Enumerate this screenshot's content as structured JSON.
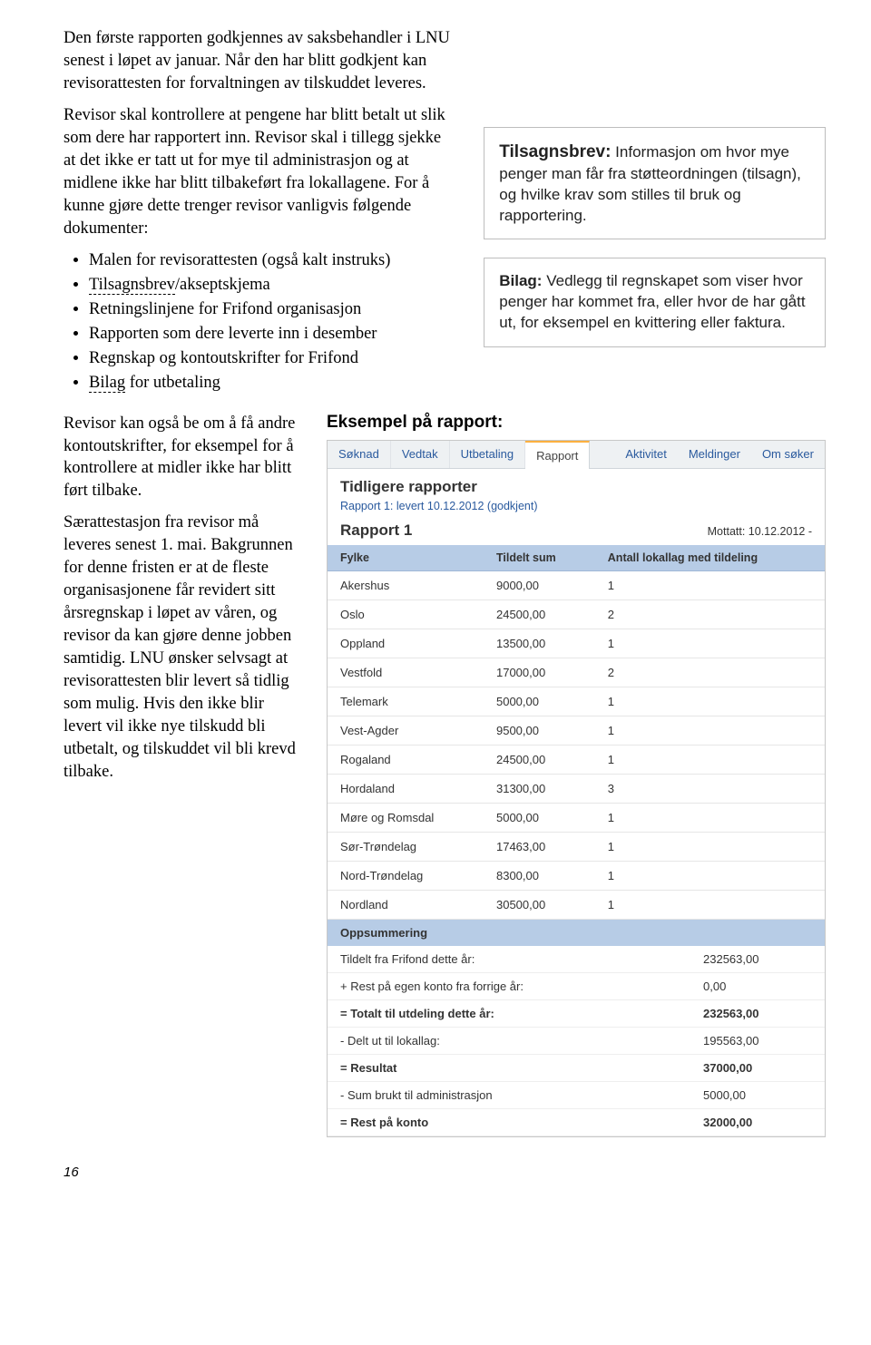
{
  "text": {
    "p1": "Den første rapporten godkjennes av saksbehandler i LNU senest i løpet av januar. Når den har blitt godkjent kan revisorattesten for forvaltningen av tilskuddet leveres.",
    "p2a": "Revisor skal kontrollere at pengene har blitt betalt ut slik som dere har rapportert inn. Revisor skal i tillegg sjekke at det ikke er tatt ut for mye til administrasjon og at midlene ikke har blitt tilbakeført fra lokallagene. For å kunne gjøre dette trenger revisor vanligvis følgende dokumenter:",
    "bullets": {
      "b1": "Malen for revisorattesten (også kalt instruks)",
      "b2a": "",
      "b2_dotted": "Tilsagnsbrev",
      "b2b": "/akseptskjema",
      "b3": "Retningslinjene for Frifond organisasjon",
      "b4": "Rapporten som dere leverte inn i desember",
      "b5": "Regnskap og kontoutskrifter for Frifond",
      "b6_dotted": "Bilag",
      "b6b": " for utbetaling"
    },
    "p3": "Revisor kan også be om å få andre kontoutskrifter, for eksempel for å kontrollere at midler ikke har blitt ført tilbake.",
    "p4": "Særattestasjon fra revisor må leveres senest 1. mai. Bakgrunnen for denne fristen er at de fleste organisasjonene får revidert sitt årsregnskap i løpet av våren, og revisor da kan gjøre denne jobben samtidig. LNU ønsker selvsagt at revisorattesten blir levert så tidlig som mulig. Hvis den ikke blir levert vil ikke nye tilskudd bli utbetalt, og tilskuddet vil bli krevd tilbake."
  },
  "callout1": {
    "label": "Tilsagnsbrev:",
    "body": " Informasjon om hvor mye penger man får fra støtteordningen (tilsagn), og hvilke krav som stilles til bruk og rapportering."
  },
  "callout2": {
    "label": "Bilag:",
    "body": " Vedlegg til regnskapet som viser hvor penger har kommet fra, eller hvor de har gått ut, for eksempel en kvittering eller faktura."
  },
  "report": {
    "example_title": "Eksempel på rapport:",
    "tabs": [
      "Søknad",
      "Vedtak",
      "Utbetaling",
      "Rapport"
    ],
    "right_tabs": [
      "Aktivitet",
      "Meldinger",
      "Om søker"
    ],
    "prev_title": "Tidligere rapporter",
    "prev_link": "Rapport 1: levert 10.12.2012 (godkjent)",
    "rname": "Rapport 1",
    "received": "Mottatt: 10.12.2012 -",
    "th": {
      "fylke": "Fylke",
      "sum": "Tildelt sum",
      "antall": "Antall lokallag med tildeling"
    },
    "rows": [
      {
        "f": "Akershus",
        "s": "9000,00",
        "a": "1"
      },
      {
        "f": "Oslo",
        "s": "24500,00",
        "a": "2"
      },
      {
        "f": "Oppland",
        "s": "13500,00",
        "a": "1"
      },
      {
        "f": "Vestfold",
        "s": "17000,00",
        "a": "2"
      },
      {
        "f": "Telemark",
        "s": "5000,00",
        "a": "1"
      },
      {
        "f": "Vest-Agder",
        "s": "9500,00",
        "a": "1"
      },
      {
        "f": "Rogaland",
        "s": "24500,00",
        "a": "1"
      },
      {
        "f": "Hordaland",
        "s": "31300,00",
        "a": "3"
      },
      {
        "f": "Møre og Romsdal",
        "s": "5000,00",
        "a": "1"
      },
      {
        "f": "Sør-Trøndelag",
        "s": "17463,00",
        "a": "1"
      },
      {
        "f": "Nord-Trøndelag",
        "s": "8300,00",
        "a": "1"
      },
      {
        "f": "Nordland",
        "s": "30500,00",
        "a": "1"
      }
    ],
    "opps_header": "Oppsummering",
    "opps": [
      {
        "label": "Tildelt fra Frifond dette år:",
        "val": "232563,00",
        "bold": false
      },
      {
        "label": "+ Rest på egen konto fra forrige år:",
        "val": "0,00",
        "bold": false
      },
      {
        "label": "= Totalt til utdeling dette år:",
        "val": "232563,00",
        "bold": true
      },
      {
        "label": "- Delt ut til lokallag:",
        "val": "195563,00",
        "bold": false
      },
      {
        "label": "= Resultat",
        "val": "37000,00",
        "bold": true
      },
      {
        "label": "- Sum brukt til administrasjon",
        "val": "5000,00",
        "bold": false
      },
      {
        "label": "= Rest på konto",
        "val": "32000,00",
        "bold": true
      }
    ]
  },
  "page_num": "16"
}
